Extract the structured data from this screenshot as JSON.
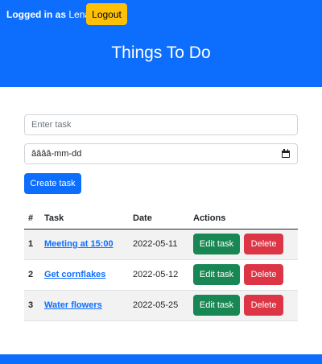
{
  "header": {
    "logged_in_label": "Logged in as",
    "username": "Lena",
    "logout_label": "Logout",
    "title": "Things To Do"
  },
  "form": {
    "task_placeholder": "Enter task",
    "task_value": "",
    "date_value": "ââââ-mm-dd",
    "create_label": "Create task"
  },
  "table": {
    "headers": [
      "#",
      "Task",
      "Date",
      "Actions"
    ],
    "rows": [
      {
        "num": "1",
        "task": "Meeting at 15:00",
        "date": "2022-05-11"
      },
      {
        "num": "2",
        "task": "Get cornflakes",
        "date": "2022-05-12"
      },
      {
        "num": "3",
        "task": "Water flowers",
        "date": "2022-05-25"
      }
    ],
    "edit_label": "Edit task",
    "delete_label": "Delete"
  },
  "colors": {
    "primary": "#0d6efd",
    "warning": "#ffc107",
    "success": "#198754",
    "danger": "#dc3545"
  },
  "icons": {
    "date_picker": "calendar-icon"
  }
}
